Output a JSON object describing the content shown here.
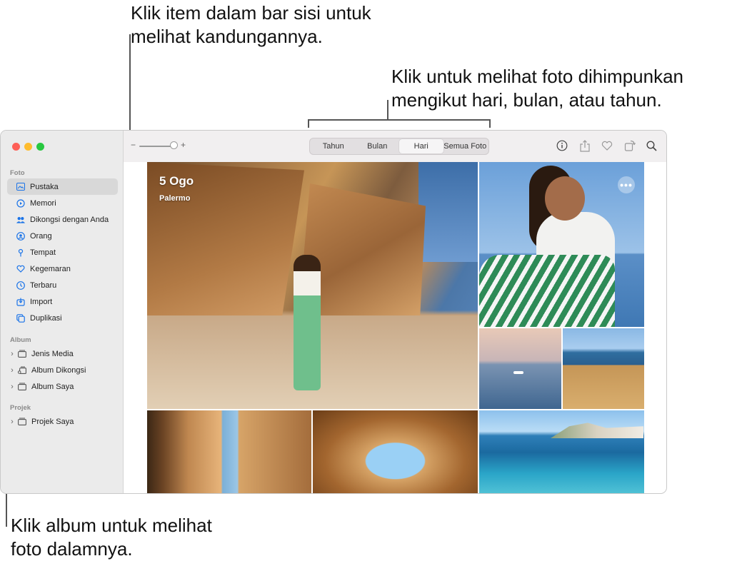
{
  "annotations": {
    "sidebar_hint": "Klik item dalam bar sisi untuk\nmelihat kandungannya.",
    "tabs_hint": "Klik untuk melihat foto dihimpunkan\nmengikut hari, bulan, atau tahun.",
    "album_hint": "Klik album untuk melihat\nfoto dalamnya."
  },
  "sidebar": {
    "sections": [
      {
        "title": "Foto",
        "items": [
          {
            "label": "Pustaka",
            "icon": "library-icon",
            "selected": true
          },
          {
            "label": "Memori",
            "icon": "memories-icon"
          },
          {
            "label": "Dikongsi dengan Anda",
            "icon": "shared-with-you-icon"
          },
          {
            "label": "Orang",
            "icon": "people-icon"
          },
          {
            "label": "Tempat",
            "icon": "places-icon"
          },
          {
            "label": "Kegemaran",
            "icon": "heart-icon"
          },
          {
            "label": "Terbaru",
            "icon": "clock-icon"
          },
          {
            "label": "Import",
            "icon": "import-icon"
          },
          {
            "label": "Duplikasi",
            "icon": "duplicates-icon"
          }
        ]
      },
      {
        "title": "Album",
        "items": [
          {
            "label": "Jenis Media",
            "icon": "folder-icon"
          },
          {
            "label": "Album Dikongsi",
            "icon": "shared-folder-icon"
          },
          {
            "label": "Album Saya",
            "icon": "folder-icon"
          }
        ]
      },
      {
        "title": "Projek",
        "items": [
          {
            "label": "Projek Saya",
            "icon": "folder-icon"
          }
        ]
      }
    ]
  },
  "toolbar": {
    "zoom_minus": "−",
    "zoom_plus": "+",
    "zoom_level": 0.95,
    "tabs": [
      "Tahun",
      "Bulan",
      "Hari",
      "Semua Foto"
    ],
    "active_tab": "Hari",
    "icons": [
      "info-icon",
      "share-icon",
      "heart-icon",
      "rotate-icon",
      "search-icon"
    ]
  },
  "photos": {
    "title": "5 Ogo",
    "location": "Palermo",
    "more_label": "•••"
  },
  "colors": {
    "accent": "#1a73e8",
    "sidebar_bg": "#ebebeb",
    "selected_bg": "#d8d8d8"
  }
}
